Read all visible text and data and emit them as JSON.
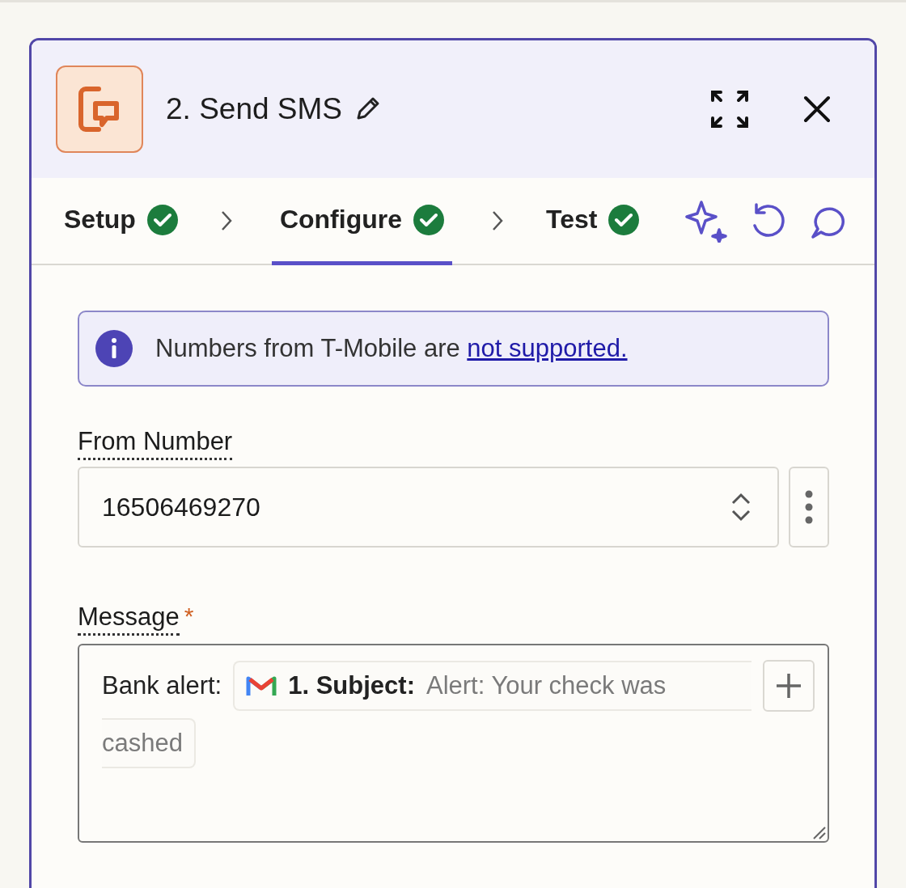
{
  "header": {
    "title": "2. Send SMS"
  },
  "steps": [
    {
      "label": "Setup",
      "complete": true,
      "selected": false
    },
    {
      "label": "Configure",
      "complete": true,
      "selected": true
    },
    {
      "label": "Test",
      "complete": true,
      "selected": false
    }
  ],
  "notice": {
    "text": "Numbers from T-Mobile are ",
    "link": "not supported."
  },
  "from_number": {
    "label": "From Number",
    "value": "16506469270"
  },
  "message": {
    "label": "Message",
    "required": true,
    "required_mark": "*",
    "prefix": "Bank alert:",
    "token": {
      "label": "1. Subject:",
      "value_lines": [
        "Alert: Your check was",
        "cashed"
      ]
    }
  }
}
